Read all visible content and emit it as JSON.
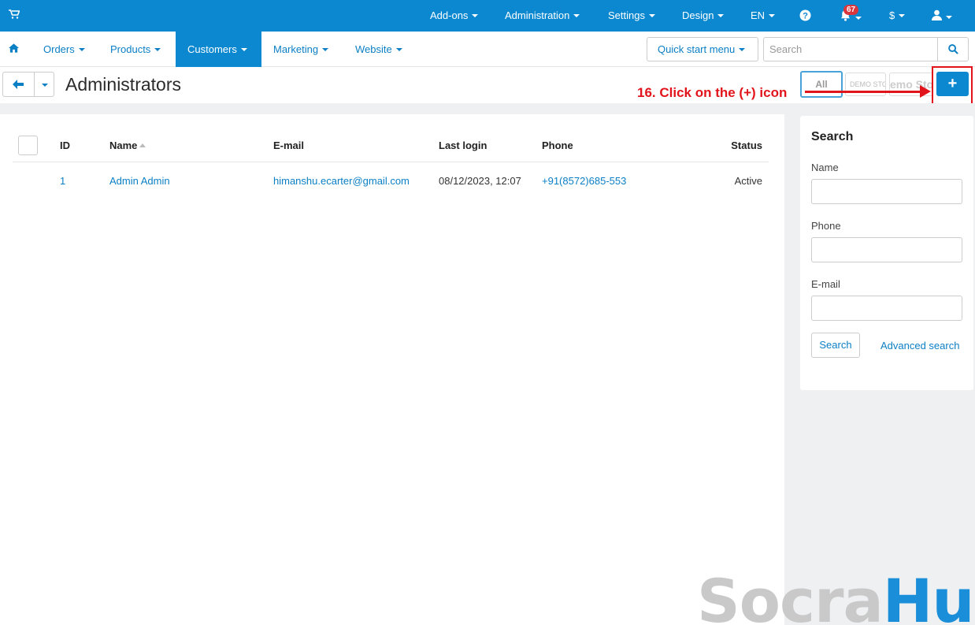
{
  "topbar": {
    "items": [
      "Add-ons",
      "Administration",
      "Settings",
      "Design",
      "EN",
      "$"
    ],
    "notification_count": "67"
  },
  "nav": {
    "items": [
      "Orders",
      "Products",
      "Customers",
      "Marketing",
      "Website"
    ],
    "active": "Customers",
    "quick_start": "Quick start menu",
    "search_placeholder": "Search"
  },
  "page": {
    "title": "Administrators",
    "storefront_all": "All",
    "storefront_demo": "DEMO STO",
    "storefront_demo2": "emo Sto",
    "add_symbol": "+"
  },
  "annotation": "16. Click on the (+) icon",
  "table": {
    "columns": [
      "ID",
      "Name",
      "E-mail",
      "Last login",
      "Phone",
      "Status"
    ],
    "rows": [
      {
        "id": "1",
        "name": "Admin Admin",
        "email": "himanshu.ecarter@gmail.com",
        "last_login": "08/12/2023, 12:07",
        "phone": "+91(8572)685-553",
        "status": "Active"
      }
    ]
  },
  "sidebar": {
    "title": "Search",
    "name_label": "Name",
    "phone_label": "Phone",
    "email_label": "E-mail",
    "search_button": "Search",
    "advanced_link": "Advanced search"
  },
  "watermark": {
    "part1": "Socra",
    "part2": "Hub"
  },
  "colors": {
    "brand": "#0b88d0",
    "annotation": "#e2141b"
  }
}
